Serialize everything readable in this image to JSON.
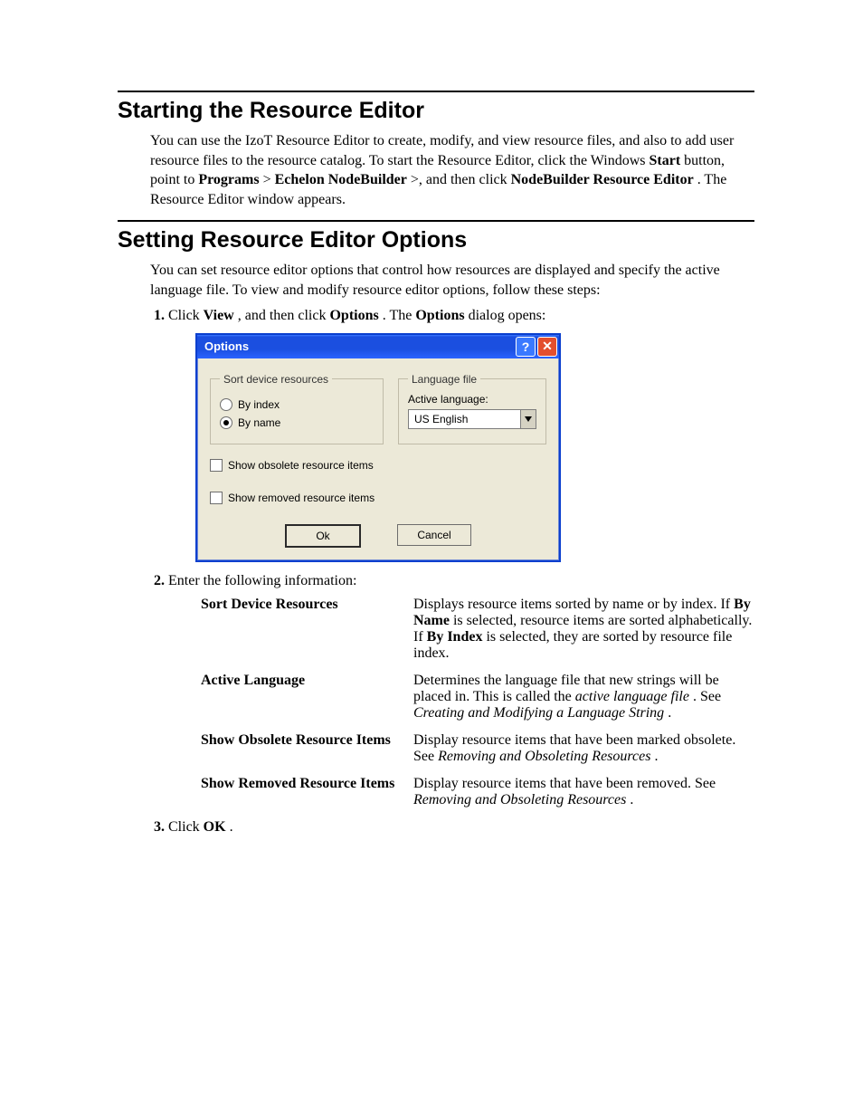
{
  "sections": {
    "starting": {
      "heading": "Starting the Resource Editor",
      "para_a": "You can use the IzoT Resource Editor to create, modify, and view resource files, and also to add user resource files to the resource catalog.  To start the Resource Editor, click the Windows ",
      "bold_start": "Start",
      "para_b": " button, point to ",
      "bold_programs": "Programs",
      "para_c": " > ",
      "bold_echelon": "Echelon NodeBuilder",
      "para_d": " >, and then click ",
      "bold_nre": "NodeBuilder Resource Editor",
      "para_e": ".  The Resource Editor window appears."
    },
    "options": {
      "heading": "Setting Resource Editor Options",
      "intro": "You can set resource editor options that control how resources are displayed and specify the active language file.  To view and modify resource editor options, follow these steps:",
      "step1_a": "Click ",
      "step1_bold_view": "View",
      "step1_b": ", and then click ",
      "step1_bold_options": "Options",
      "step1_c": ".  The ",
      "step1_bold_options2": "Options",
      "step1_d": " dialog opens:",
      "step2": "Enter the following information:",
      "step3_a": "Click ",
      "step3_bold_ok": "OK",
      "step3_b": "."
    }
  },
  "dialog": {
    "title": "Options",
    "sort_legend": "Sort device resources",
    "radio_by_index": "By index",
    "radio_by_name": "By name",
    "lang_legend": "Language file",
    "active_language_label": "Active language:",
    "active_language_value": "US English",
    "chk_obsolete": "Show obsolete resource items",
    "chk_removed": "Show removed resource items",
    "btn_ok": "Ok",
    "btn_cancel": "Cancel"
  },
  "definitions": {
    "sort": {
      "term": "Sort Device Resources",
      "d1": "Displays resource items sorted by name or by index.  If ",
      "b1": "By Name",
      "d2": " is selected, resource items are sorted alphabetically.  If ",
      "b2": "By Index",
      "d3": " is selected, they are sorted by resource file index."
    },
    "lang": {
      "term": "Active Language",
      "d1": "Determines the language file that new strings will be placed in.  This is called the ",
      "i1": "active language file",
      "d2": ".  See ",
      "i2": "Creating and Modifying a Language String",
      "d3": "."
    },
    "obsolete": {
      "term": "Show Obsolete Resource Items",
      "d1": "Display resource items that have been marked obsolete.  See ",
      "i1": "Removing and Obsoleting Resources",
      "d2": "."
    },
    "removed": {
      "term": "Show Removed Resource Items",
      "d1": "Display resource items that have been removed.  See ",
      "i1": "Removing and Obsoleting Resources",
      "d2": "."
    }
  }
}
